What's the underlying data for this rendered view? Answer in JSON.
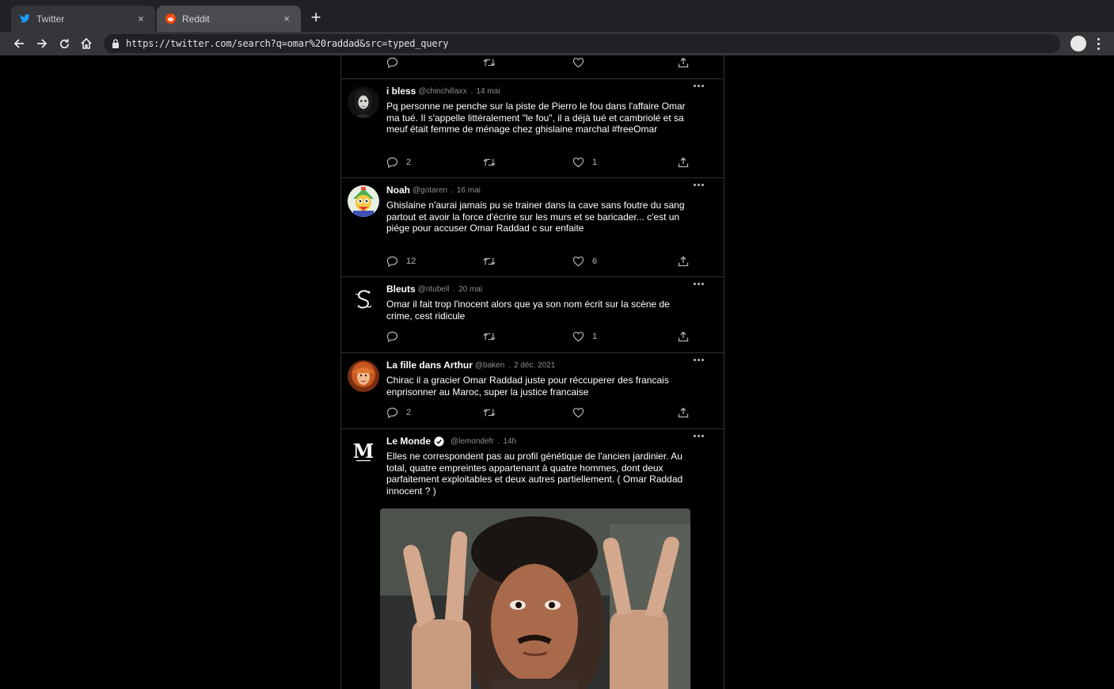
{
  "browser": {
    "tabs": [
      {
        "title": "Twitter",
        "icon": "twitter-bird-icon",
        "active": false
      },
      {
        "title": "Reddit",
        "icon": "reddit-icon",
        "active": true
      }
    ],
    "close_glyph": "×",
    "new_tab_glyph": "+",
    "url": "https://twitter.com/search?q=omar%20raddad&src=typed_query"
  },
  "colors": {
    "background": "#000000",
    "border": "#2f3336",
    "secondary_text": "#8b8f93",
    "tab_bar": "#202124",
    "toolbar": "#35363a",
    "twitter_blue": "#1d9bf0",
    "reddit_orange": "#ff4500"
  },
  "tweets": [
    {
      "name": "i bless",
      "handle": "@chinchillaxx",
      "separator": ".",
      "date": "14 mai",
      "text": "Pq personne ne penche sur la piste de Pierro le fou dans l'affaire Omar ma tué. Il s'appelle littéralement \"le fou\", il a déjà tué et cambriolé et sa meuf était femme de ménage chez ghislaine marchal #freeOmar",
      "replies": "2",
      "retweets": "",
      "likes": "1"
    },
    {
      "name": "Noah",
      "handle": "@gotaren",
      "separator": ".",
      "date": "16 mai",
      "text": "Ghislaine n'aurai jamais pu se trainer dans la cave sans foutre du sang partout et avoir la force d'écrire sur les murs et se baricader... c'est un piége pour accuser Omar Raddad c sur enfaite",
      "replies": "12",
      "retweets": "",
      "likes": "6"
    },
    {
      "name": "Bleuts",
      "handle": "@ritubell",
      "separator": ".",
      "date": "20 mai",
      "text": "Omar il fait trop l'inocent alors que ya son nom écrit sur la scène de crime, cest ridicule",
      "replies": "",
      "retweets": "",
      "likes": "1"
    },
    {
      "name": "La fille dans Arthur",
      "handle": "@baken",
      "separator": ".",
      "date": "2 déc. 2021",
      "text": "Chirac il a gracier Omar Raddad juste pour réccuperer des francais enprisonner au Maroc, super la justice francaise",
      "replies": "2",
      "retweets": "",
      "likes": ""
    },
    {
      "name": "Le Monde",
      "handle": "@lemondefr",
      "separator": ".",
      "date": "14h",
      "verified": true,
      "text": "Elles ne correspondent pas au profil génétique de l'ancien jardinier. Au total, quatre empreintes appartenant à quatre hommes, dont deux parfaitement exploitables et deux autres partiellement. ( Omar Raddad innocent ? )",
      "replies": "",
      "retweets": "",
      "likes": ""
    }
  ]
}
